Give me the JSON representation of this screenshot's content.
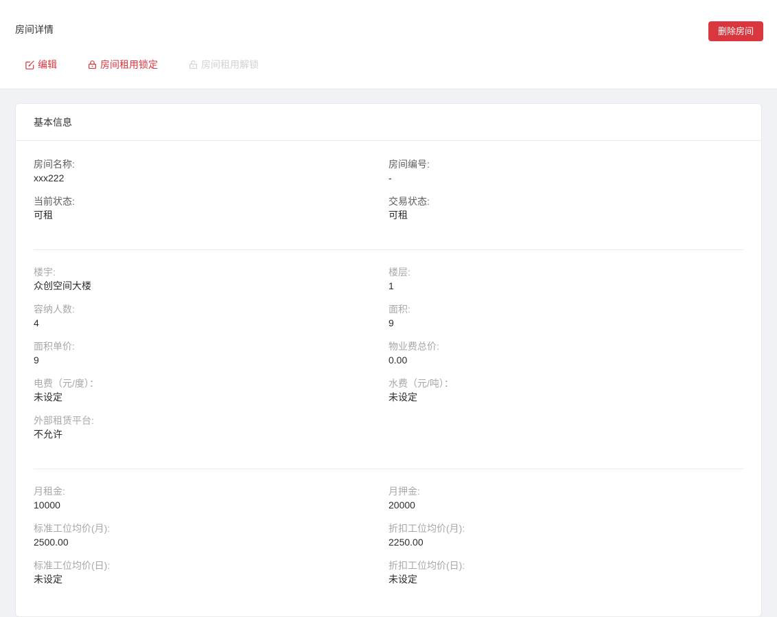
{
  "page": {
    "title": "房间详情"
  },
  "header": {
    "delete_button_label": "删除房间",
    "actions": {
      "edit": {
        "label": "编辑",
        "state": "enabled"
      },
      "lock": {
        "label": "房间租用锁定",
        "state": "enabled"
      },
      "unlock": {
        "label": "房间租用解锁",
        "state": "disabled"
      }
    }
  },
  "card": {
    "title": "基本信息",
    "sections": [
      {
        "fields": [
          {
            "label": "房间名称:",
            "value": "xxx222"
          },
          {
            "label": "房间编号:",
            "value": "-"
          },
          {
            "label": "当前状态:",
            "value": "可租"
          },
          {
            "label": "交易状态:",
            "value": "可租"
          }
        ]
      },
      {
        "fields": [
          {
            "label": "楼宇:",
            "value": "众创空间大楼"
          },
          {
            "label": "楼层:",
            "value": "1"
          },
          {
            "label": "容纳人数:",
            "value": "4"
          },
          {
            "label": "面积:",
            "value": "9"
          },
          {
            "label": "面积单价:",
            "value": "9"
          },
          {
            "label": "物业费总价:",
            "value": "0.00"
          },
          {
            "label": "电费（元/度）：",
            "value": "未设定"
          },
          {
            "label": "水费（元/吨）：",
            "value": "未设定"
          },
          {
            "label": "外部租赁平台:",
            "value": "不允许"
          }
        ]
      },
      {
        "fields": [
          {
            "label": "月租金:",
            "value": "10000"
          },
          {
            "label": "月押金:",
            "value": "20000"
          },
          {
            "label": "标准工位均价(月):",
            "value": "2500.00"
          },
          {
            "label": "折扣工位均价(月):",
            "value": "2250.00"
          },
          {
            "label": "标准工位均价(日):",
            "value": "未设定"
          },
          {
            "label": "折扣工位均价(日):",
            "value": "未设定"
          }
        ]
      }
    ]
  },
  "colors": {
    "accent_red": "#d9363e",
    "disabled_gray": "#d2d2d2",
    "page_background": "#f0f2f5",
    "card_border": "#e8e8e8"
  },
  "icons": {
    "edit": "edit-square-icon",
    "lock": "lock-icon",
    "unlock": "unlock-icon"
  }
}
